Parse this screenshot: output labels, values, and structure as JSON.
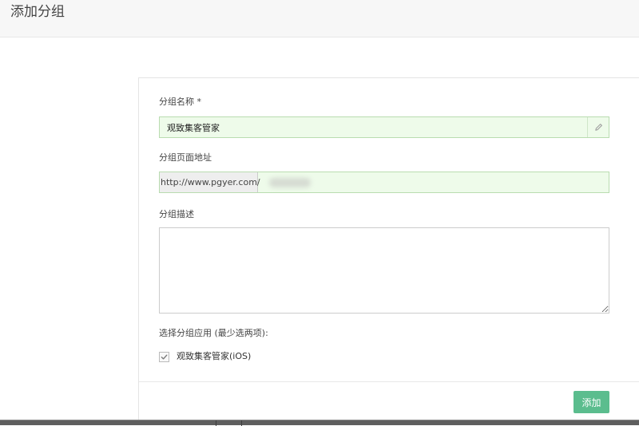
{
  "header": {
    "title": "添加分组"
  },
  "form": {
    "name": {
      "label": "分组名称 *",
      "value": "观致集客管家",
      "addon_icon": "pencil-icon"
    },
    "url": {
      "label": "分组页面地址",
      "prefix": "http://www.pgyer.com/",
      "value": ""
    },
    "description": {
      "label": "分组描述",
      "value": ""
    },
    "apps": {
      "label": "选择分组应用 (最少选两项):",
      "items": [
        {
          "label": "观致集客管家(iOS)",
          "checked": true
        }
      ]
    },
    "submit_label": "添加"
  },
  "colors": {
    "accent": "#5bbd8e",
    "valid_field_bg": "#eefbea",
    "valid_field_border": "#b9dcb0"
  }
}
